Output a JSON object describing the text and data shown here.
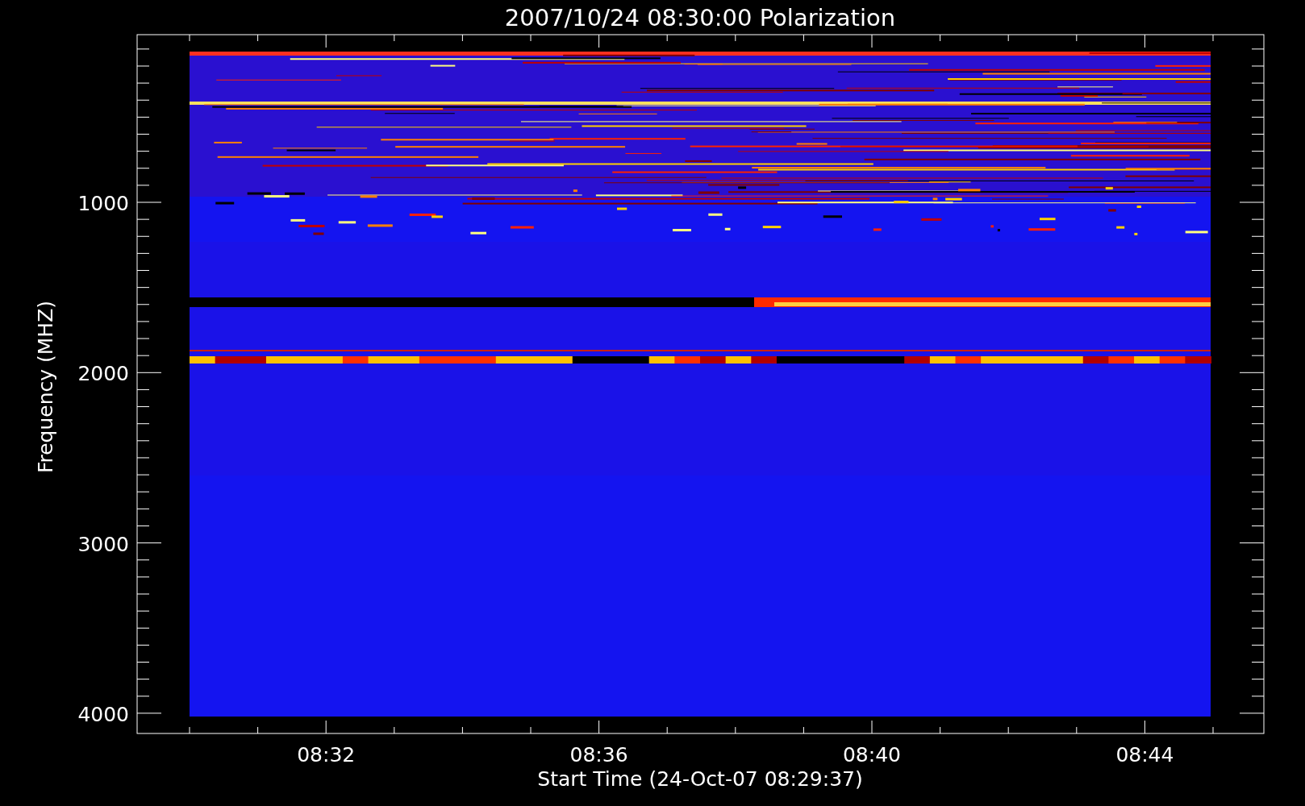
{
  "plot": {
    "title": "2007/10/24 08:30:00 Polarization",
    "xlabel": "Start Time (24-Oct-07 08:29:37)",
    "ylabel": "Frequency (MHZ)",
    "xticks": [
      {
        "label": "08:32"
      },
      {
        "label": "08:36"
      },
      {
        "label": "08:40"
      },
      {
        "label": "08:44"
      }
    ],
    "yticks": [
      {
        "label": "1000"
      },
      {
        "label": "2000"
      },
      {
        "label": "3000"
      },
      {
        "label": "4000"
      }
    ]
  }
}
